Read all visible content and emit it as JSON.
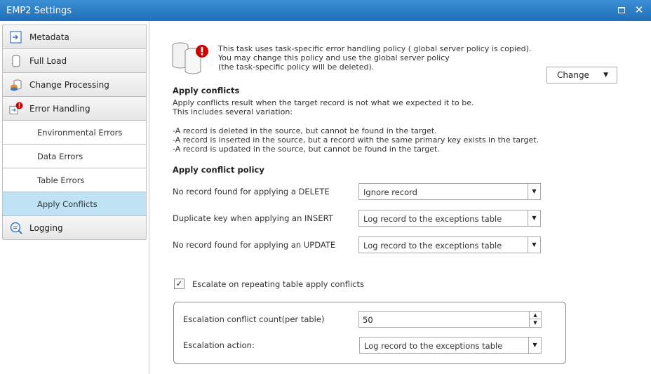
{
  "window": {
    "title": "EMP2 Settings"
  },
  "sidebar": {
    "items": [
      {
        "label": "Metadata",
        "icon": "metadata-icon"
      },
      {
        "label": "Full Load",
        "icon": "database-icon"
      },
      {
        "label": "Change Processing",
        "icon": "change-processing-icon"
      },
      {
        "label": "Error Handling",
        "icon": "error-handling-icon"
      },
      {
        "label": "Environmental Errors"
      },
      {
        "label": "Data Errors"
      },
      {
        "label": "Table Errors"
      },
      {
        "label": "Apply Conflicts",
        "selected": true
      },
      {
        "label": "Logging",
        "icon": "logging-icon"
      }
    ]
  },
  "policy_notice": {
    "lines": [
      "This task uses task-specific error handling policy ( global server policy is copied).",
      "You may change this policy and use the global server policy",
      "(the task-specific policy will be deleted)."
    ],
    "change_button": "Change"
  },
  "apply_conflicts": {
    "heading": "Apply conflicts",
    "lines": [
      "Apply conflicts result when the target record is not what we expected it to be.",
      "This includes several variation:",
      "",
      "-A record is deleted in the source, but cannot be found in the target.",
      "-A record is inserted in the source, but a record with the same primary key exists in the target.",
      "-A record is updated in the source, but cannot be found in the target."
    ]
  },
  "policy": {
    "heading": "Apply conflict policy",
    "rows": [
      {
        "label": "No record found for applying a DELETE",
        "value": "Ignore record"
      },
      {
        "label": "Duplicate key when applying an INSERT",
        "value": "Log record to the exceptions table"
      },
      {
        "label": "No record found for applying an UPDATE",
        "value": "Log record to the exceptions table"
      }
    ]
  },
  "escalation": {
    "checkbox_label": "Escalate on repeating table apply conflicts",
    "checked": true,
    "count_label": "Escalation conflict count(per table)",
    "count_value": "50",
    "action_label": "Escalation action:",
    "action_value": "Log record to the exceptions table"
  },
  "colors": {
    "titlebar": "#2a7cc7",
    "selected_item": "#bfe3f5",
    "error_badge": "#cc0000"
  }
}
